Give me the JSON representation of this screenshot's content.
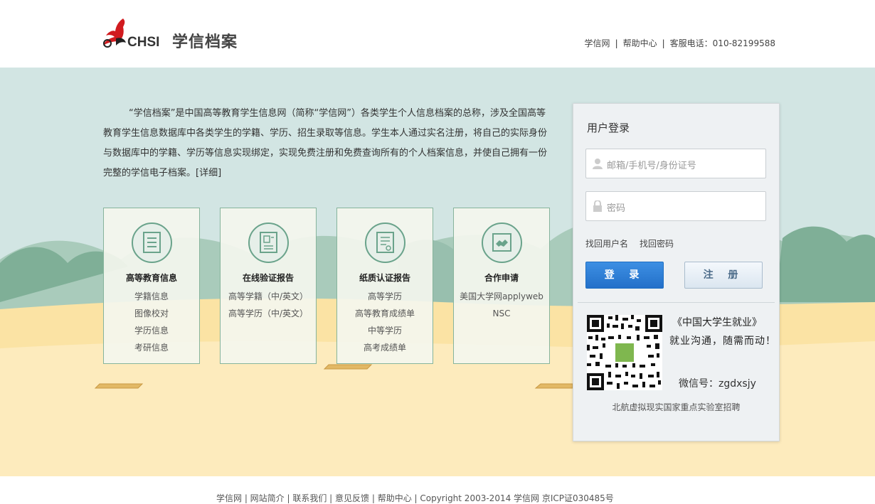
{
  "header": {
    "logo_text": "CHSI",
    "site_name": "学信档案",
    "links": [
      "学信网",
      "帮助中心"
    ],
    "phone": "客服电话：010-82199588"
  },
  "intro": {
    "text": "“学信档案”是中国高等教育学生信息网（简称“学信网”）各类学生个人信息档案的总称，涉及全国高等教育学生信息数据库中各类学生的学籍、学历、招生录取等信息。学生本人通过实名注册，将自己的实际身份与数据库中的学籍、学历等信息实现绑定，实现免费注册和免费查询所有的个人档案信息，并使自己拥有一份完整的学信电子档案。",
    "more": "[详细]"
  },
  "cards": [
    {
      "title": "高等教育信息",
      "items": [
        "学籍信息",
        "图像校对",
        "学历信息",
        "考研信息"
      ]
    },
    {
      "title": "在线验证报告",
      "items": [
        "高等学籍（中/英文）",
        "高等学历（中/英文）"
      ]
    },
    {
      "title": "纸质认证报告",
      "items": [
        "高等学历",
        "高等教育成绩单",
        "中等学历",
        "高考成绩单"
      ]
    },
    {
      "title": "合作申请",
      "items": [
        "美国大学网applyweb",
        "NSC"
      ]
    }
  ],
  "login": {
    "title": "用户登录",
    "username_placeholder": "邮箱/手机号/身份证号",
    "password_placeholder": "密码",
    "forgot_username": "找回用户名",
    "forgot_password": "找回密码",
    "login_button": "登 录",
    "register_button": "注 册",
    "promo_title": "《中国大学生就业》",
    "promo_slogan": "就业沟通，随需而动！",
    "wechat": "微信号：zgdxsjy",
    "lab_ad": "北航虚拟现实国家重点实验室招聘"
  },
  "footer": {
    "text": "学信网  |  网站简介  |  联系我们  |  意见反馈  |  帮助中心  |  Copyright 2003-2014 学信网 京ICP证030485号"
  },
  "colors": {
    "background": "#d2e5e3",
    "sand": "#fbe8b0",
    "hills": "#8ab8a2",
    "login_button": "#2d7fd6"
  }
}
